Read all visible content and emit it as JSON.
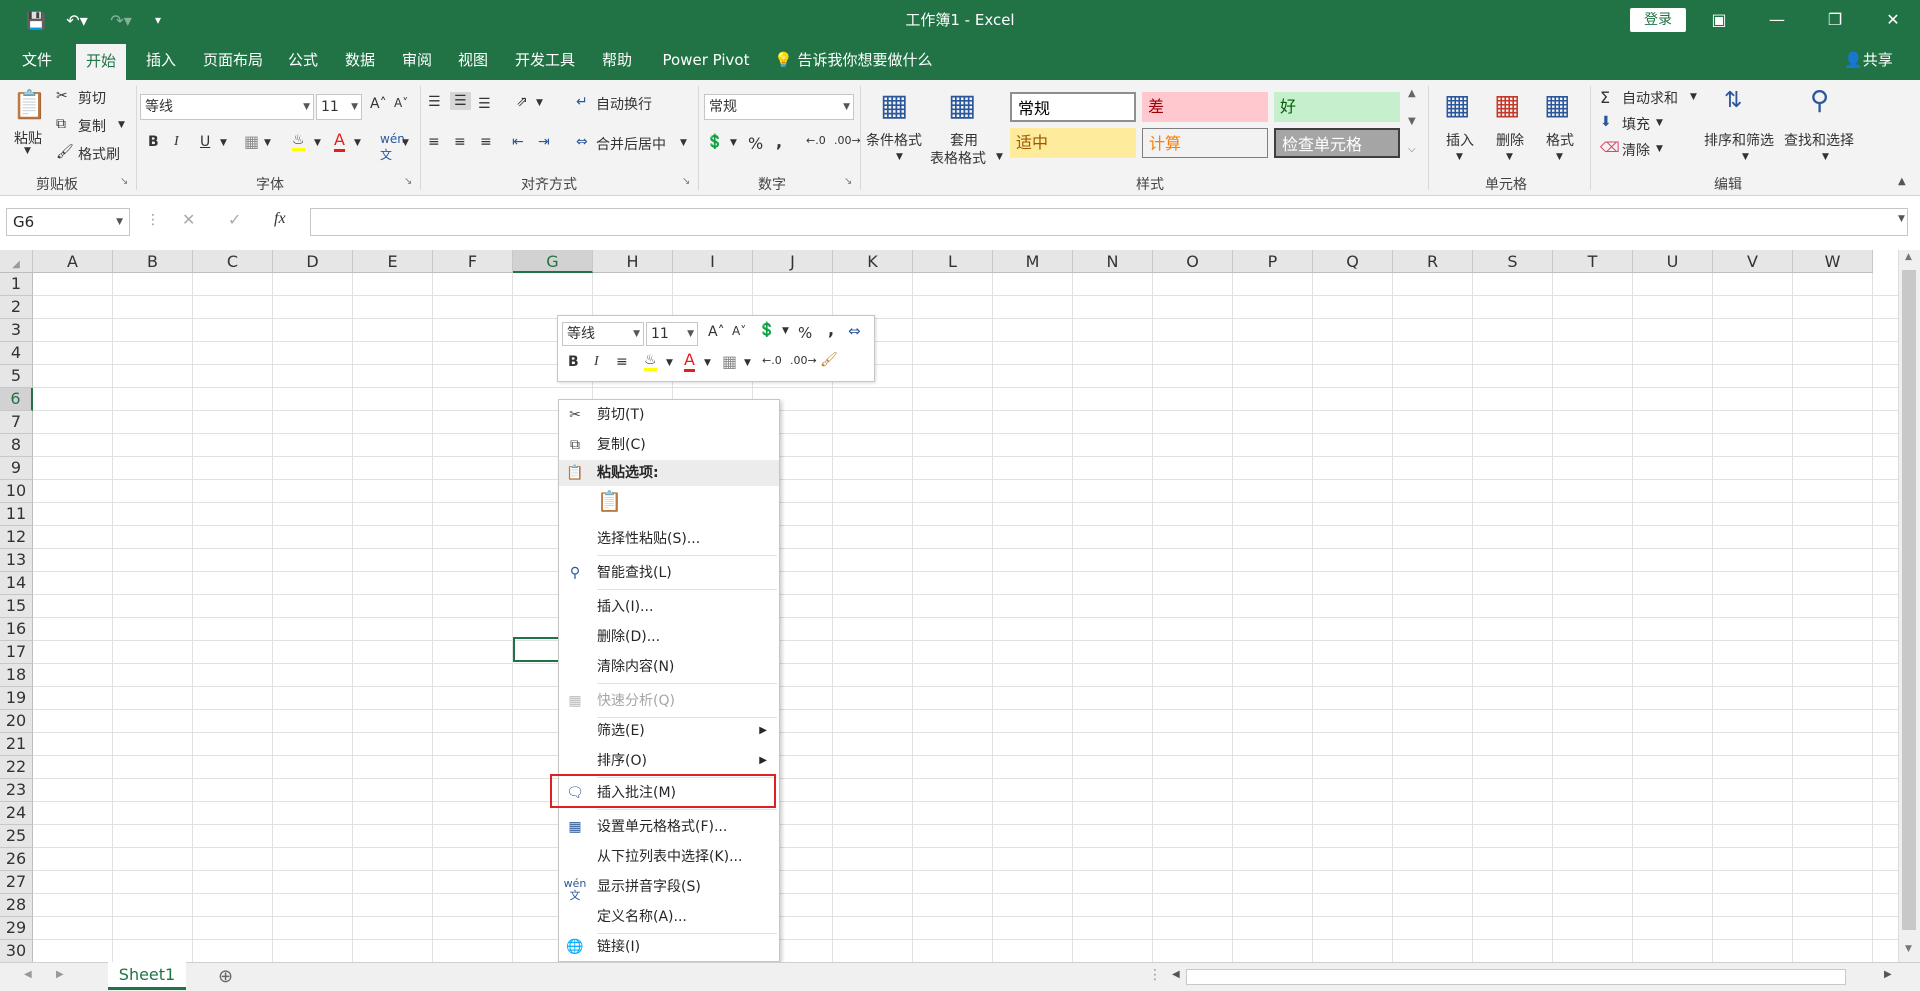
{
  "app": {
    "title": "工作簿1  -  Excel",
    "login_label": "登录",
    "share_label": "共享",
    "tell_me": "告诉我你想要做什么"
  },
  "tabs": [
    "文件",
    "开始",
    "插入",
    "页面布局",
    "公式",
    "数据",
    "审阅",
    "视图",
    "开发工具",
    "帮助",
    "Power Pivot"
  ],
  "ribbon": {
    "clipboard": {
      "label": "剪贴板",
      "paste": "粘贴",
      "cut": "剪切",
      "copy": "复制",
      "format_painter": "格式刷"
    },
    "font": {
      "label": "字体",
      "font_name": "等线",
      "font_size": "11"
    },
    "alignment": {
      "label": "对齐方式",
      "wrap": "自动换行",
      "merge": "合并后居中"
    },
    "number": {
      "label": "数字",
      "format": "常规"
    },
    "styles": {
      "label": "样式",
      "conditional": "条件格式",
      "table_format_1": "套用",
      "table_format_2": "表格格式",
      "cells": [
        {
          "name": "常规",
          "bg": "#ffffff",
          "fg": "#000000"
        },
        {
          "name": "差",
          "bg": "#ffc7ce",
          "fg": "#9c0006"
        },
        {
          "name": "好",
          "bg": "#c6efce",
          "fg": "#006100"
        },
        {
          "name": "适中",
          "bg": "#ffeb9c",
          "fg": "#9c5700"
        },
        {
          "name": "计算",
          "bg": "#f2f2f2",
          "fg": "#fa7d00"
        },
        {
          "name": "检查单元格",
          "bg": "#a5a5a5",
          "fg": "#ffffff"
        }
      ]
    },
    "cells_group": {
      "label": "单元格",
      "insert": "插入",
      "delete": "删除",
      "format": "格式"
    },
    "editing": {
      "label": "编辑",
      "autosum": "自动求和",
      "fill": "填充",
      "clear": "清除",
      "sort": "排序和筛选",
      "find": "查找和选择"
    }
  },
  "formula_bar": {
    "name_box": "G6",
    "fx": "fx"
  },
  "columns": [
    "A",
    "B",
    "C",
    "D",
    "E",
    "F",
    "G",
    "H",
    "I",
    "J",
    "K",
    "L",
    "M",
    "N",
    "O",
    "P",
    "Q",
    "R",
    "S",
    "T",
    "U",
    "V",
    "W"
  ],
  "rows": [
    "1",
    "2",
    "3",
    "4",
    "5",
    "6",
    "7",
    "8",
    "9",
    "10",
    "11",
    "12",
    "13",
    "14",
    "15",
    "16",
    "17",
    "18",
    "19",
    "20",
    "21",
    "22",
    "23",
    "24",
    "25",
    "26",
    "27",
    "28",
    "29",
    "30"
  ],
  "selected": {
    "column": "G",
    "row": "6"
  },
  "mini_toolbar": {
    "font": "等线",
    "size": "11"
  },
  "context_menu": [
    {
      "id": "cut",
      "label": "剪切(T)",
      "icon": "scissors-icon"
    },
    {
      "id": "copy",
      "label": "复制(C)",
      "icon": "copy-icon"
    },
    {
      "id": "paste-options",
      "label": "粘贴选项:",
      "icon": "paste-icon",
      "header": true
    },
    {
      "id": "paste-special",
      "label": "选择性粘贴(S)..."
    },
    {
      "id": "smart-lookup",
      "label": "智能查找(L)",
      "icon": "smart-lookup-icon"
    },
    {
      "id": "insert",
      "label": "插入(I)..."
    },
    {
      "id": "delete",
      "label": "删除(D)..."
    },
    {
      "id": "clear-contents",
      "label": "清除内容(N)"
    },
    {
      "id": "quick-analysis",
      "label": "快速分析(Q)",
      "icon": "quick-analysis-icon",
      "disabled": true
    },
    {
      "id": "filter",
      "label": "筛选(E)",
      "submenu": true
    },
    {
      "id": "sort",
      "label": "排序(O)",
      "submenu": true
    },
    {
      "id": "insert-comment",
      "label": "插入批注(M)",
      "icon": "comment-icon"
    },
    {
      "id": "format-cells",
      "label": "设置单元格格式(F)...",
      "icon": "format-cells-icon"
    },
    {
      "id": "pick-from-list",
      "label": "从下拉列表中选择(K)..."
    },
    {
      "id": "phonetic",
      "label": "显示拼音字段(S)",
      "icon": "phonetic-icon"
    },
    {
      "id": "define-name",
      "label": "定义名称(A)..."
    },
    {
      "id": "link",
      "label": "链接(I)",
      "icon": "link-icon"
    }
  ],
  "sheet": {
    "tab": "Sheet1"
  },
  "colors": {
    "accent": "#217346",
    "highlight": "#e02020"
  }
}
